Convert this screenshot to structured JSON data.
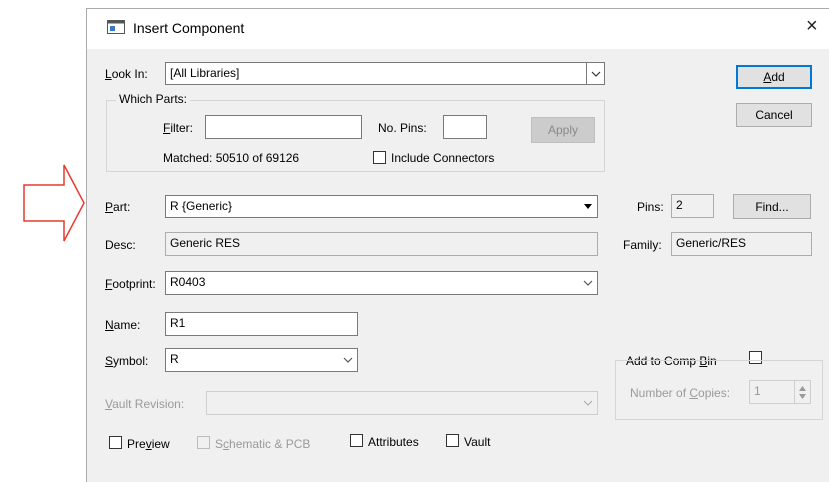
{
  "dialog": {
    "title": "Insert Component",
    "close_glyph": "×"
  },
  "look_in": {
    "label": "Look In:",
    "value": "[All Libraries]"
  },
  "buttons": {
    "add": "Add",
    "cancel": "Cancel",
    "apply": "Apply",
    "find": "Find..."
  },
  "which_parts": {
    "legend": "Which Parts:",
    "filter_label": "Filter:",
    "filter_value": "",
    "pins_label": "No. Pins:",
    "pins_value": "",
    "matched": "Matched: 50510 of 69126",
    "include_connectors": "Include Connectors"
  },
  "part": {
    "label": "Part:",
    "value": "R {Generic}"
  },
  "pins": {
    "label": "Pins:",
    "value": "2"
  },
  "desc": {
    "label": "Desc:",
    "value": "Generic RES"
  },
  "family": {
    "label": "Family:",
    "value": "Generic/RES"
  },
  "footprint": {
    "label": "Footprint:",
    "value": "R0403"
  },
  "name": {
    "label": "Name:",
    "value": "R1"
  },
  "symbol": {
    "label": "Symbol:",
    "value": "R"
  },
  "vault_revision": {
    "label": "Vault Revision:",
    "value": ""
  },
  "comp_bin": {
    "label": "Add to Comp Bin",
    "copies_label": "Number of Copies:",
    "copies_value": "1"
  },
  "options": {
    "preview": "Preview",
    "schematic_pcb": "Schematic & PCB",
    "attributes": "Attributes",
    "vault": "Vault"
  },
  "colors": {
    "arrow": "#e83a2e",
    "accent": "#0078d7"
  },
  "icons": [
    "arrow-right-outline-icon",
    "app-window-icon",
    "close-icon",
    "chevron-down-icon",
    "spin-up-icon",
    "spin-down-icon"
  ]
}
